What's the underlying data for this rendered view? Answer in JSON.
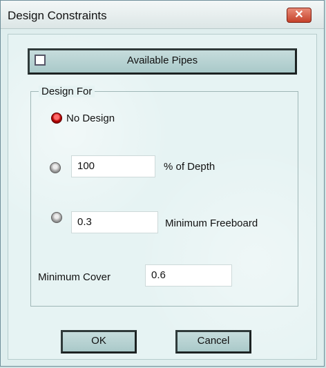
{
  "window": {
    "title": "Design Constraints"
  },
  "available_pipes": {
    "label": "Available Pipes",
    "checked": false
  },
  "design_for": {
    "group_label": "Design For",
    "options": [
      {
        "label": "No Design",
        "selected": true
      },
      {
        "value": "100",
        "label": "% of Depth",
        "selected": false
      },
      {
        "value": "0.3",
        "label": "Minimum Freeboard",
        "selected": false
      }
    ]
  },
  "minimum_cover": {
    "label": "Minimum Cover",
    "value": "0.6"
  },
  "buttons": {
    "ok": "OK",
    "cancel": "Cancel"
  },
  "colors": {
    "selected_radio": "#cc0000",
    "unselected_radio": "#8f8f8f",
    "dialog_bg": "#e6f3f3"
  }
}
